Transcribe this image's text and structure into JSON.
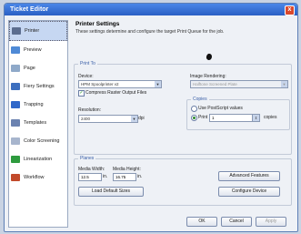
{
  "window": {
    "title": "Ticket Editor",
    "close_glyph": "x"
  },
  "sidebar": {
    "items": [
      {
        "label": "Printer",
        "icon": "printer-icon",
        "color": "#5b6d8f",
        "active": true
      },
      {
        "label": "Preview",
        "icon": "preview-icon",
        "color": "#4f8ad6"
      },
      {
        "label": "Page",
        "icon": "page-icon",
        "color": "#8fa9c9"
      },
      {
        "label": "Fiery Settings",
        "icon": "fiery-settings-icon",
        "color": "#3d6fbf"
      },
      {
        "label": "Trapping",
        "icon": "trapping-icon",
        "color": "#2f67c9"
      },
      {
        "label": "Templates",
        "icon": "templates-icon",
        "color": "#6b82b0"
      },
      {
        "label": "Color Screening",
        "icon": "color-screening-icon",
        "color": "#a7b5cd"
      },
      {
        "label": "Linearization",
        "icon": "linearization-icon",
        "color": "#2e9b3e"
      },
      {
        "label": "Workflow",
        "icon": "workflow-icon",
        "color": "#c24a2a"
      }
    ]
  },
  "main": {
    "title": "Printer Settings",
    "description": "These settings determine and configure the target Print Queue for the job.",
    "print_to": {
      "group_label": "Print To",
      "device_label": "Device:",
      "device_value": "HPM Spoolprinter v2",
      "compress_label": "Compress Raster Output Files",
      "compress_checked": true,
      "rendering_label": "Image Rendering:",
      "rendering_value": "Halftone Screened Plate",
      "resolution_label": "Resolution:",
      "resolution_value": "2400",
      "resolution_unit": "dpi",
      "copies_label": "Copies",
      "use_postscript_label": "Use PostScript values",
      "print_label": "Print",
      "print_value": "1",
      "copies_unit": "copies"
    },
    "planes": {
      "group_label": "Planes",
      "media_width_label": "Media Width:",
      "media_width_value": "12.5",
      "media_width_unit": "in.",
      "media_height_label": "Media Height:",
      "media_height_value": "16.75",
      "media_height_unit": "in.",
      "load_default_label": "Load Default Sizes",
      "advanced_features_label": "Advanced Features",
      "configure_device_label": "Configure Device"
    },
    "footer": {
      "ok_label": "OK",
      "cancel_label": "Cancel",
      "apply_label": "Apply"
    }
  }
}
